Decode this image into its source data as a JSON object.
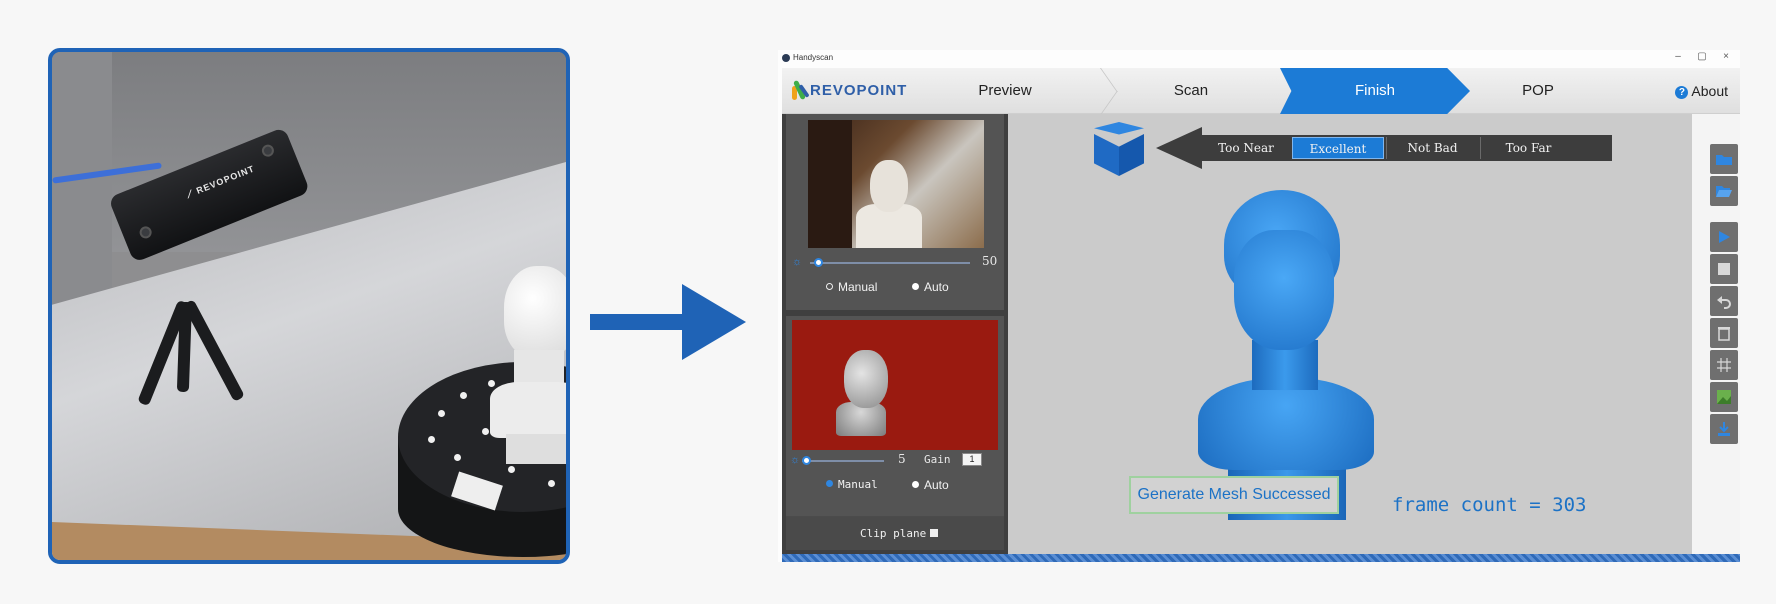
{
  "app": {
    "window_title": "Handyscan",
    "brand": "REVOPOINT",
    "controls": {
      "minimize": "–",
      "maximize": "▢",
      "close": "×"
    }
  },
  "nav": {
    "steps": [
      {
        "label": "Preview",
        "active": false
      },
      {
        "label": "Scan",
        "active": false
      },
      {
        "label": "Finish",
        "active": true
      },
      {
        "label": "POP",
        "active": false
      }
    ],
    "about": "About",
    "accent_color": "#1c7bd6"
  },
  "rgb_panel": {
    "exposure_value": "50",
    "exposure_level": 0.05,
    "modes": [
      "Manual",
      "Auto"
    ],
    "selected_mode": "Auto"
  },
  "depth_panel": {
    "exposure_value": "5",
    "exposure_level": 0.05,
    "gain_label": "Gain",
    "gain_value": "1",
    "modes": [
      "Manual",
      "Auto"
    ],
    "selected_mode": "Manual",
    "clip_plane_label": "Clip plane"
  },
  "distance_indicator": {
    "options": [
      "Too Near",
      "Excellent",
      "Not Bad",
      "Too Far"
    ],
    "selected": "Excellent"
  },
  "viewport": {
    "status_message": "Generate Mesh Successed",
    "frame_count_text": "frame count = 303",
    "mesh_color": "#2f8fe6"
  },
  "toolbar": {
    "tools": [
      "folder-icon",
      "open-folder-icon",
      "play-icon",
      "stop-icon",
      "undo-icon",
      "delete-icon",
      "grid-icon",
      "texture-icon",
      "download-icon"
    ]
  }
}
